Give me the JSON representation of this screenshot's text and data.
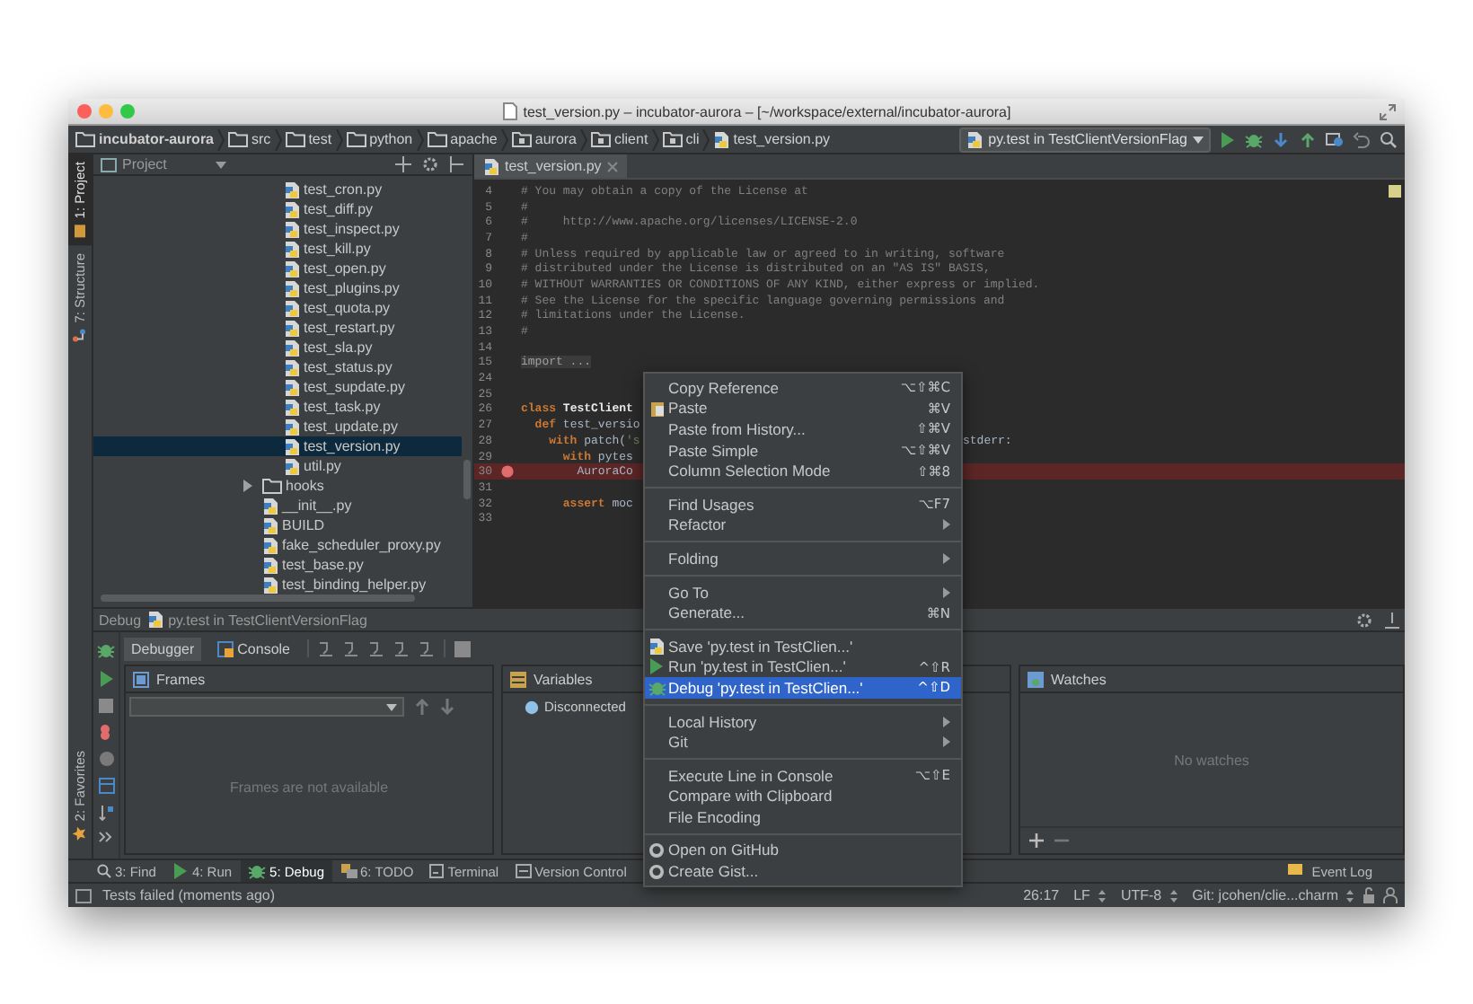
{
  "window": {
    "title": "test_version.py – incubator-aurora – [~/workspace/external/incubator-aurora]"
  },
  "breadcrumbs": [
    {
      "label": "incubator-aurora",
      "kind": "project"
    },
    {
      "label": "src",
      "kind": "folder"
    },
    {
      "label": "test",
      "kind": "folder"
    },
    {
      "label": "python",
      "kind": "folder"
    },
    {
      "label": "apache",
      "kind": "folder"
    },
    {
      "label": "aurora",
      "kind": "package"
    },
    {
      "label": "client",
      "kind": "package"
    },
    {
      "label": "cli",
      "kind": "package"
    },
    {
      "label": "test_version.py",
      "kind": "file"
    }
  ],
  "run_config": {
    "label": "py.test in TestClientVersionFlag"
  },
  "side_tabs_top": [
    {
      "label": "1: Project",
      "kind": "project",
      "selected": true
    },
    {
      "label": "7: Structure",
      "kind": "structure",
      "selected": false
    }
  ],
  "side_tabs_bottom": [
    {
      "label": "2: Favorites",
      "kind": "favorites",
      "selected": false
    }
  ],
  "project": {
    "title": "Project",
    "tree": [
      {
        "children": [
          {
            "label": "test_cron.py",
            "kind": "file",
            "selected": false
          },
          {
            "label": "test_diff.py",
            "kind": "file",
            "selected": false
          },
          {
            "label": "test_inspect.py",
            "kind": "file",
            "selected": false
          },
          {
            "label": "test_kill.py",
            "kind": "file",
            "selected": false
          },
          {
            "label": "test_open.py",
            "kind": "file",
            "selected": false
          },
          {
            "label": "test_plugins.py",
            "kind": "file",
            "selected": false
          },
          {
            "label": "test_quota.py",
            "kind": "file",
            "selected": false
          },
          {
            "label": "test_restart.py",
            "kind": "file",
            "selected": false
          },
          {
            "label": "test_sla.py",
            "kind": "file",
            "selected": false
          },
          {
            "label": "test_status.py",
            "kind": "file",
            "selected": false
          },
          {
            "label": "test_supdate.py",
            "kind": "file",
            "selected": false
          },
          {
            "label": "test_task.py",
            "kind": "file",
            "selected": false
          },
          {
            "label": "test_update.py",
            "kind": "file",
            "selected": false
          },
          {
            "label": "test_version.py",
            "kind": "file",
            "selected": true
          },
          {
            "label": "util.py",
            "kind": "file",
            "selected": false
          }
        ]
      },
      {
        "label": "hooks",
        "kind": "folder",
        "expanded": false,
        "selected": false
      },
      {
        "label": "__init__.py",
        "kind": "file",
        "selected": false
      },
      {
        "label": "BUILD",
        "kind": "file",
        "selected": false
      },
      {
        "label": "fake_scheduler_proxy.py",
        "kind": "file",
        "selected": false
      },
      {
        "label": "test_base.py",
        "kind": "file",
        "selected": false
      },
      {
        "label": "test_binding_helper.py",
        "kind": "file",
        "selected": false
      }
    ]
  },
  "editor": {
    "tabs": [
      {
        "label": "test_version.py",
        "selected": true
      }
    ],
    "lines": [
      {
        "num": "4",
        "breakpoint": false,
        "segments": [
          {
            "t": "# You may obtain a copy of the License at",
            "kind": "comment"
          }
        ]
      },
      {
        "num": "5",
        "breakpoint": false,
        "segments": [
          {
            "t": "#",
            "kind": "comment"
          }
        ]
      },
      {
        "num": "6",
        "breakpoint": false,
        "segments": [
          {
            "t": "#     http://www.apache.org/licenses/LICENSE-2.0",
            "kind": "comment"
          }
        ]
      },
      {
        "num": "7",
        "breakpoint": false,
        "segments": [
          {
            "t": "#",
            "kind": "comment"
          }
        ]
      },
      {
        "num": "8",
        "breakpoint": false,
        "segments": [
          {
            "t": "# Unless required by applicable law or agreed to in writing, software",
            "kind": "comment"
          }
        ]
      },
      {
        "num": "9",
        "breakpoint": false,
        "segments": [
          {
            "t": "# distributed under the License is distributed on an \"AS IS\" BASIS,",
            "kind": "comment"
          }
        ]
      },
      {
        "num": "10",
        "breakpoint": false,
        "segments": [
          {
            "t": "# WITHOUT WARRANTIES OR CONDITIONS OF ANY KIND, either express or implied.",
            "kind": "comment"
          }
        ]
      },
      {
        "num": "11",
        "breakpoint": false,
        "segments": [
          {
            "t": "# See the License for the specific language governing permissions and",
            "kind": "comment"
          }
        ]
      },
      {
        "num": "12",
        "breakpoint": false,
        "segments": [
          {
            "t": "# limitations under the License.",
            "kind": "comment"
          }
        ]
      },
      {
        "num": "13",
        "breakpoint": false,
        "segments": [
          {
            "t": "#",
            "kind": "comment"
          }
        ]
      },
      {
        "num": "14",
        "breakpoint": false
      },
      {
        "num": "15",
        "breakpoint": false,
        "segments": [
          {
            "t": "import ...",
            "kind": "folded"
          }
        ]
      },
      {
        "num": "24",
        "breakpoint": false
      },
      {
        "num": "25",
        "breakpoint": false
      },
      {
        "num": "26",
        "breakpoint": false,
        "segments": [
          {
            "t": "class",
            "kind": "keyword"
          },
          {
            "t": " TestClient",
            "kind": "classname"
          }
        ]
      },
      {
        "num": "27",
        "breakpoint": false,
        "segments": [
          {
            "t": "  def",
            "kind": "keyword"
          },
          {
            "t": " test_versio",
            "kind": "plain"
          }
        ]
      },
      {
        "num": "28",
        "breakpoint": false,
        "segments": [
          {
            "t": "    with",
            "kind": "keyword"
          },
          {
            "t": " patch(",
            "kind": "plain"
          },
          {
            "t": "'s",
            "kind": "string"
          }
        ],
        "tail": "stderr:"
      },
      {
        "num": "29",
        "breakpoint": false,
        "segments": [
          {
            "t": "      with",
            "kind": "keyword"
          },
          {
            "t": " pytes",
            "kind": "plain"
          }
        ]
      },
      {
        "num": "30",
        "breakpoint": true,
        "segments": [
          {
            "t": "        AuroraCo",
            "kind": "plain"
          }
        ]
      },
      {
        "num": "31",
        "breakpoint": false
      },
      {
        "num": "32",
        "breakpoint": false,
        "segments": [
          {
            "t": "      assert",
            "kind": "keyword"
          },
          {
            "t": " moc",
            "kind": "plain"
          }
        ]
      },
      {
        "num": "33",
        "breakpoint": false
      }
    ]
  },
  "debug": {
    "title": "Debug",
    "config": "py.test in TestClientVersionFlag",
    "tabs": [
      {
        "label": "Debugger",
        "selected": true
      },
      {
        "label": "Console",
        "selected": false
      }
    ],
    "frames": {
      "title": "Frames",
      "empty_text": "Frames are not available"
    },
    "variables": {
      "title": "Variables",
      "items": [
        {
          "label": "Disconnected"
        }
      ]
    },
    "watches": {
      "title": "Watches",
      "empty_text": "No watches"
    }
  },
  "context_menu": [
    {
      "kind": "item",
      "label": "Copy Reference",
      "shortcut": "⌥⇧⌘C",
      "submenu": false,
      "selected": false
    },
    {
      "kind": "clipboard",
      "label": "Paste",
      "shortcut": "⌘V",
      "submenu": false,
      "selected": false
    },
    {
      "kind": "item",
      "label": "Paste from History...",
      "shortcut": "⇧⌘V",
      "submenu": false,
      "selected": false
    },
    {
      "kind": "item",
      "label": "Paste Simple",
      "shortcut": "⌥⇧⌘V",
      "submenu": false,
      "selected": false
    },
    {
      "kind": "item",
      "label": "Column Selection Mode",
      "shortcut": "⇧⌘8",
      "submenu": false,
      "selected": false
    },
    {
      "kind": "separator"
    },
    {
      "kind": "item",
      "label": "Find Usages",
      "shortcut": "⌥F7",
      "submenu": false,
      "selected": false
    },
    {
      "kind": "item",
      "label": "Refactor",
      "submenu": true,
      "selected": false
    },
    {
      "kind": "separator"
    },
    {
      "kind": "item",
      "label": "Folding",
      "submenu": true,
      "selected": false
    },
    {
      "kind": "separator"
    },
    {
      "kind": "item",
      "label": "Go To",
      "submenu": true,
      "selected": false
    },
    {
      "kind": "item",
      "label": "Generate...",
      "shortcut": "⌘N",
      "submenu": false,
      "selected": false
    },
    {
      "kind": "separator"
    },
    {
      "kind": "python",
      "label": "Save 'py.test in TestClien...'",
      "submenu": false,
      "selected": false
    },
    {
      "kind": "run",
      "label": "Run 'py.test in TestClien...'",
      "shortcut": "^⇧R",
      "submenu": false,
      "selected": false
    },
    {
      "kind": "debug",
      "label": "Debug 'py.test in TestClien...'",
      "shortcut": "^⇧D",
      "submenu": false,
      "selected": true
    },
    {
      "kind": "separator"
    },
    {
      "kind": "item",
      "label": "Local History",
      "submenu": true,
      "selected": false
    },
    {
      "kind": "item",
      "label": "Git",
      "submenu": true,
      "selected": false
    },
    {
      "kind": "separator"
    },
    {
      "kind": "item",
      "label": "Execute Line in Console",
      "shortcut": "⌥⇧E",
      "submenu": false,
      "selected": false
    },
    {
      "kind": "item",
      "label": "Compare with Clipboard",
      "submenu": false,
      "selected": false
    },
    {
      "kind": "item",
      "label": "File Encoding",
      "submenu": false,
      "selected": false
    },
    {
      "kind": "separator"
    },
    {
      "kind": "github",
      "label": "Open on GitHub",
      "submenu": false,
      "selected": false
    },
    {
      "kind": "github",
      "label": "Create Gist...",
      "submenu": false,
      "selected": false
    }
  ],
  "tool_tabs": [
    {
      "label": "3: Find",
      "kind": "find",
      "selected": false
    },
    {
      "label": "4: Run",
      "kind": "run",
      "selected": false
    },
    {
      "label": "5: Debug",
      "kind": "debug",
      "selected": true
    },
    {
      "label": "6: TODO",
      "kind": "todo",
      "selected": false
    },
    {
      "label": "Terminal",
      "kind": "terminal",
      "selected": false
    },
    {
      "label": "Version Control",
      "kind": "vcs",
      "selected": false
    }
  ],
  "event_log": {
    "label": "Event Log"
  },
  "status_bar": {
    "message": "Tests failed (moments ago)",
    "position": "26:17",
    "line_separator": "LF",
    "encoding": "UTF-8",
    "vcs": "Git: jcohen/clie...charm"
  }
}
